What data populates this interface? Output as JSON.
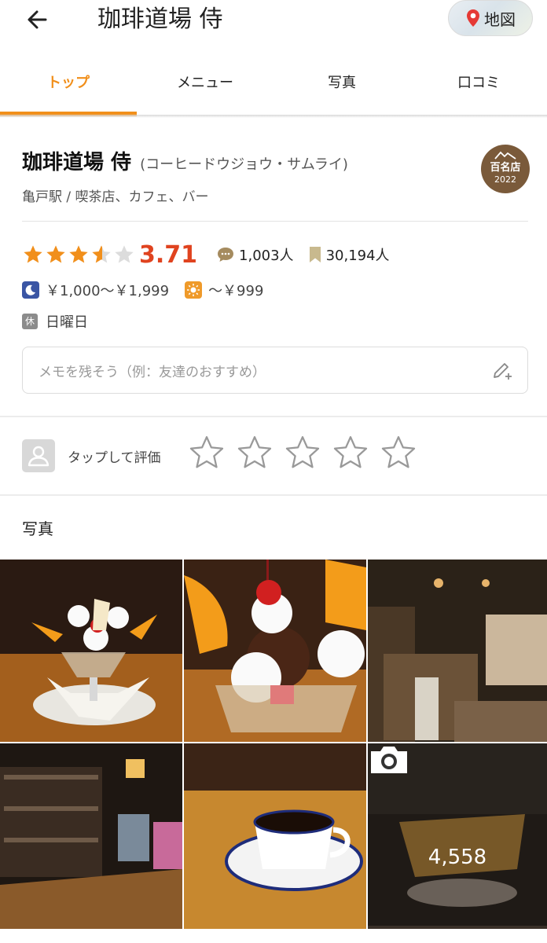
{
  "header": {
    "title": "珈琲道場 侍",
    "map_label": "地図"
  },
  "tabs": [
    {
      "label": "トップ",
      "active": true
    },
    {
      "label": "メニュー",
      "active": false
    },
    {
      "label": "写真",
      "active": false
    },
    {
      "label": "口コミ",
      "active": false
    }
  ],
  "shop": {
    "name": "珈琲道場 侍",
    "kana": "(コーヒードウジョウ・サムライ)",
    "genre": "亀戸駅 / 喫茶店、カフェ、バー",
    "badge": {
      "line1": "百名店",
      "line2": "2022"
    },
    "rating": {
      "stars": 3.71,
      "score": "3.71"
    },
    "reviews": "1,003人",
    "bookmarks": "30,194人",
    "price_dinner": "￥1,000～￥1,999",
    "price_lunch": "～￥999",
    "holiday_icon": "休",
    "holiday": "日曜日"
  },
  "memo": {
    "placeholder": "メモを残そう（例：友達のおすすめ）"
  },
  "rate": {
    "label": "タップして評価"
  },
  "photos": {
    "title": "写真",
    "count": "4,558"
  },
  "colors": {
    "accent": "#f18f1b",
    "score": "#e0431f",
    "badge": "#7a5a3a"
  }
}
